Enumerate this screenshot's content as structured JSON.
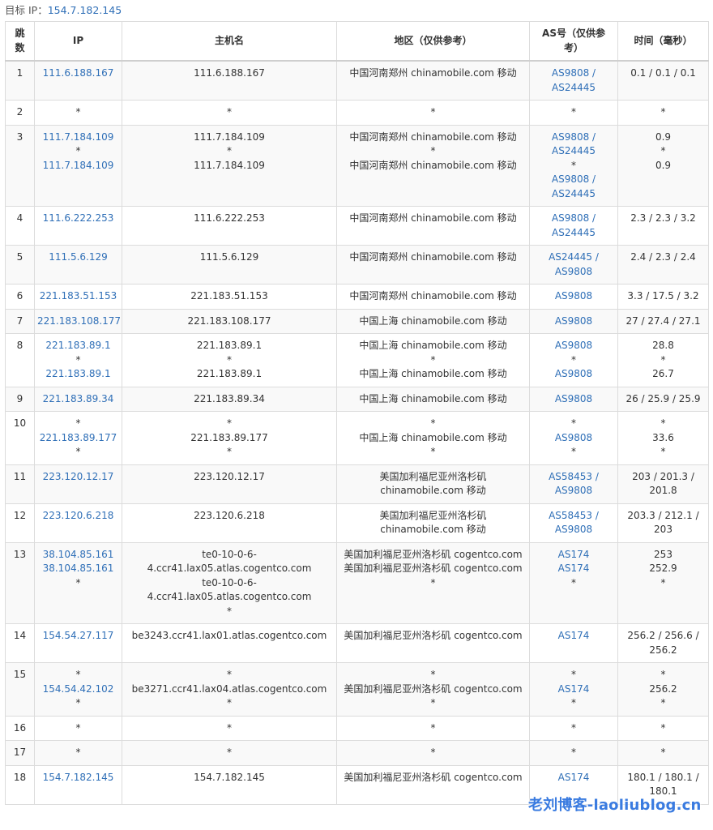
{
  "target": {
    "label": "目标 IP：",
    "ip": "154.7.182.145"
  },
  "headers": {
    "hop": "跳数",
    "ip": "IP",
    "host": "主机名",
    "region": "地区（仅供参考）",
    "asn": "AS号（仅供参考）",
    "time": "时间（毫秒）"
  },
  "rows": [
    {
      "hop": "1",
      "ip": [
        "111.6.188.167"
      ],
      "host": [
        "111.6.188.167"
      ],
      "region": [
        "中国河南郑州 chinamobile.com 移动"
      ],
      "asn": [
        "AS9808 /",
        "AS24445"
      ],
      "time": [
        "0.1 / 0.1 / 0.1"
      ]
    },
    {
      "hop": "2",
      "ip": [
        "*"
      ],
      "host": [
        "*"
      ],
      "region": [
        "*"
      ],
      "asn": [
        "*"
      ],
      "time": [
        "*"
      ]
    },
    {
      "hop": "3",
      "ip": [
        "111.7.184.109",
        "*",
        "111.7.184.109"
      ],
      "host": [
        "111.7.184.109",
        "*",
        "111.7.184.109"
      ],
      "region": [
        "中国河南郑州 chinamobile.com 移动",
        "*",
        "中国河南郑州 chinamobile.com 移动"
      ],
      "asn": [
        "AS9808 /",
        "AS24445",
        "*",
        "AS9808 /",
        "AS24445"
      ],
      "time": [
        "0.9",
        "*",
        "0.9"
      ]
    },
    {
      "hop": "4",
      "ip": [
        "111.6.222.253"
      ],
      "host": [
        "111.6.222.253"
      ],
      "region": [
        "中国河南郑州 chinamobile.com 移动"
      ],
      "asn": [
        "AS9808 /",
        "AS24445"
      ],
      "time": [
        "2.3 / 2.3 / 3.2"
      ]
    },
    {
      "hop": "5",
      "ip": [
        "111.5.6.129"
      ],
      "host": [
        "111.5.6.129"
      ],
      "region": [
        "中国河南郑州 chinamobile.com 移动"
      ],
      "asn": [
        "AS24445 /",
        "AS9808"
      ],
      "time": [
        "2.4 / 2.3 / 2.4"
      ]
    },
    {
      "hop": "6",
      "ip": [
        "221.183.51.153"
      ],
      "host": [
        "221.183.51.153"
      ],
      "region": [
        "中国河南郑州 chinamobile.com 移动"
      ],
      "asn": [
        "AS9808"
      ],
      "time": [
        "3.3 / 17.5 / 3.2"
      ]
    },
    {
      "hop": "7",
      "ip": [
        "221.183.108.177"
      ],
      "host": [
        "221.183.108.177"
      ],
      "region": [
        "中国上海 chinamobile.com 移动"
      ],
      "asn": [
        "AS9808"
      ],
      "time": [
        "27 / 27.4 / 27.1"
      ]
    },
    {
      "hop": "8",
      "ip": [
        "221.183.89.1",
        "*",
        "221.183.89.1"
      ],
      "host": [
        "221.183.89.1",
        "*",
        "221.183.89.1"
      ],
      "region": [
        "中国上海 chinamobile.com 移动",
        "*",
        "中国上海 chinamobile.com 移动"
      ],
      "asn": [
        "AS9808",
        "*",
        "AS9808"
      ],
      "time": [
        "28.8",
        "*",
        "26.7"
      ]
    },
    {
      "hop": "9",
      "ip": [
        "221.183.89.34"
      ],
      "host": [
        "221.183.89.34"
      ],
      "region": [
        "中国上海 chinamobile.com 移动"
      ],
      "asn": [
        "AS9808"
      ],
      "time": [
        "26 / 25.9 / 25.9"
      ]
    },
    {
      "hop": "10",
      "ip": [
        "*",
        "221.183.89.177",
        "*"
      ],
      "host": [
        "*",
        "221.183.89.177",
        "*"
      ],
      "region": [
        "*",
        "中国上海 chinamobile.com 移动",
        "*"
      ],
      "asn": [
        "*",
        "AS9808",
        "*"
      ],
      "time": [
        "*",
        "33.6",
        "*"
      ]
    },
    {
      "hop": "11",
      "ip": [
        "223.120.12.17"
      ],
      "host": [
        "223.120.12.17"
      ],
      "region": [
        "美国加利福尼亚州洛杉矶",
        "chinamobile.com 移动"
      ],
      "asn": [
        "AS58453 /",
        "AS9808"
      ],
      "time": [
        "203 / 201.3 /",
        "201.8"
      ]
    },
    {
      "hop": "12",
      "ip": [
        "223.120.6.218"
      ],
      "host": [
        "223.120.6.218"
      ],
      "region": [
        "美国加利福尼亚州洛杉矶",
        "chinamobile.com 移动"
      ],
      "asn": [
        "AS58453 /",
        "AS9808"
      ],
      "time": [
        "203.3 / 212.1 /",
        "203"
      ]
    },
    {
      "hop": "13",
      "ip": [
        "38.104.85.161",
        "38.104.85.161",
        "*"
      ],
      "host": [
        "te0-10-0-6-",
        "4.ccr41.lax05.atlas.cogentco.com",
        "te0-10-0-6-",
        "4.ccr41.lax05.atlas.cogentco.com",
        "*"
      ],
      "region": [
        "美国加利福尼亚州洛杉矶 cogentco.com",
        "美国加利福尼亚州洛杉矶 cogentco.com",
        "*"
      ],
      "asn": [
        "AS174",
        "AS174",
        "*"
      ],
      "time": [
        "253",
        "252.9",
        "*"
      ]
    },
    {
      "hop": "14",
      "ip": [
        "154.54.27.117"
      ],
      "host": [
        "be3243.ccr41.lax01.atlas.cogentco.com"
      ],
      "region": [
        "美国加利福尼亚州洛杉矶 cogentco.com"
      ],
      "asn": [
        "AS174"
      ],
      "time": [
        "256.2 / 256.6 /",
        "256.2"
      ]
    },
    {
      "hop": "15",
      "ip": [
        "*",
        "154.54.42.102",
        "*"
      ],
      "host": [
        "*",
        "be3271.ccr41.lax04.atlas.cogentco.com",
        "*"
      ],
      "region": [
        "*",
        "美国加利福尼亚州洛杉矶 cogentco.com",
        "*"
      ],
      "asn": [
        "*",
        "AS174",
        "*"
      ],
      "time": [
        "*",
        "256.2",
        "*"
      ]
    },
    {
      "hop": "16",
      "ip": [
        "*"
      ],
      "host": [
        "*"
      ],
      "region": [
        "*"
      ],
      "asn": [
        "*"
      ],
      "time": [
        "*"
      ]
    },
    {
      "hop": "17",
      "ip": [
        "*"
      ],
      "host": [
        "*"
      ],
      "region": [
        "*"
      ],
      "asn": [
        "*"
      ],
      "time": [
        "*"
      ]
    },
    {
      "hop": "18",
      "ip": [
        "154.7.182.145"
      ],
      "host": [
        "154.7.182.145"
      ],
      "region": [
        "美国加利福尼亚州洛杉矶 cogentco.com"
      ],
      "asn": [
        "AS174"
      ],
      "time": [
        "180.1 / 180.1 /",
        "180.1"
      ]
    }
  ],
  "watermark": "老刘博客-laoliublog.cn"
}
